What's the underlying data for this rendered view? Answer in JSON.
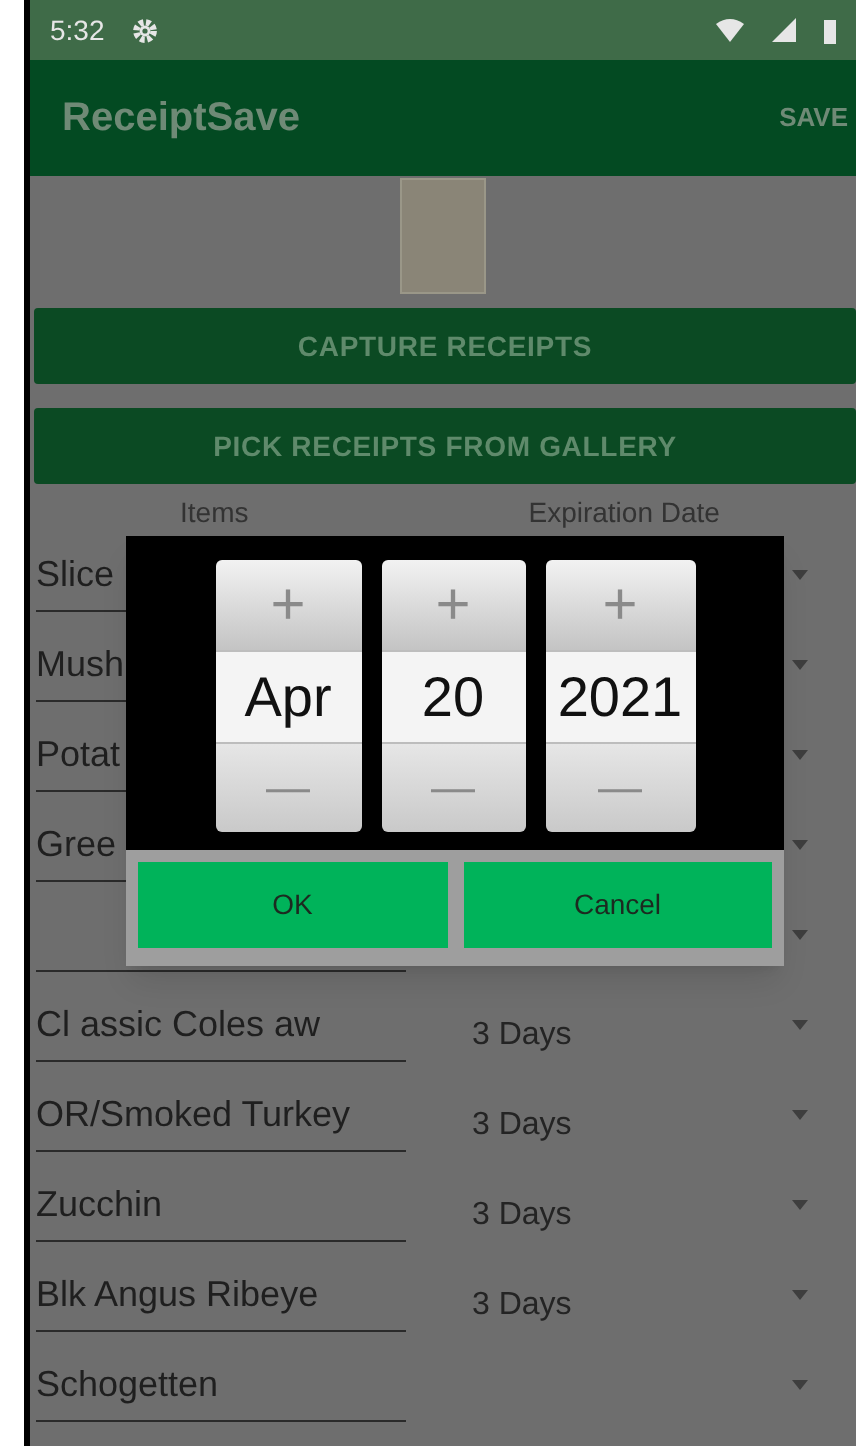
{
  "status_bar": {
    "time": "5:32"
  },
  "app_bar": {
    "title": "ReceiptSave",
    "action": "SAVE"
  },
  "buttons": [
    "CAPTURE RECEIPTS",
    "PICK RECEIPTS FROM GALLERY"
  ],
  "table": {
    "columns": [
      "Items",
      "Expiration Date"
    ],
    "rows": [
      {
        "item": "Slice",
        "expiration": ""
      },
      {
        "item": "Mush",
        "expiration": ""
      },
      {
        "item": "Potat",
        "expiration": ""
      },
      {
        "item": "Gree",
        "expiration": ""
      },
      {
        "item": "",
        "expiration": ""
      },
      {
        "item": "Cl assic Coles aw",
        "expiration": "3 Days"
      },
      {
        "item": "OR/Smoked Turkey",
        "expiration": "3 Days"
      },
      {
        "item": "Zucchin",
        "expiration": "3 Days"
      },
      {
        "item": "Blk Angus Ribeye",
        "expiration": "3 Days"
      },
      {
        "item": "Schogetten",
        "expiration": ""
      }
    ]
  },
  "date_dialog": {
    "fields": [
      {
        "kind": "month",
        "value": "Apr"
      },
      {
        "kind": "day",
        "value": "20"
      },
      {
        "kind": "year",
        "value": "2021"
      }
    ],
    "plus": "+",
    "minus": "—",
    "ok": "OK",
    "cancel": "Cancel"
  }
}
